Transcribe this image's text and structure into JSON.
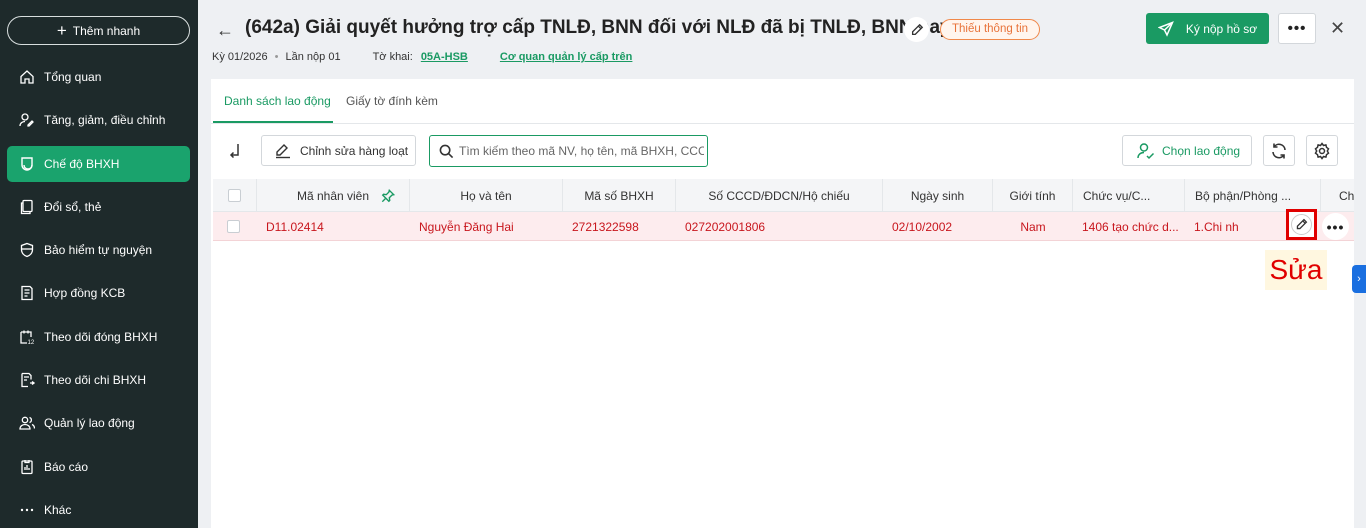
{
  "sidebar": {
    "quick_add": "Thêm nhanh",
    "items": [
      {
        "label": "Tổng quan",
        "icon": "home-icon"
      },
      {
        "label": "Tăng, giảm, điều chỉnh",
        "icon": "user-edit-icon"
      },
      {
        "label": "Chế độ BHXH",
        "icon": "shield-health-icon",
        "active": true
      },
      {
        "label": "Đổi sổ, thẻ",
        "icon": "copy-card-icon"
      },
      {
        "label": "Bảo hiểm tự nguyện",
        "icon": "shield-icon"
      },
      {
        "label": "Hợp đồng KCB",
        "icon": "contract-icon"
      },
      {
        "label": "Theo dõi đóng BHXH",
        "icon": "calendar-track-icon"
      },
      {
        "label": "Theo dõi chi BHXH",
        "icon": "document-track-icon"
      },
      {
        "label": "Quản lý lao động",
        "icon": "users-icon"
      },
      {
        "label": "Báo cáo",
        "icon": "report-icon"
      },
      {
        "label": "Khác",
        "icon": "more-dots-icon"
      }
    ]
  },
  "header": {
    "title": "(642a) Giải quyết hưởng trợ cấp TNLĐ, BNN đối với NLĐ đã bị TNLĐ, BNN nay...",
    "badge": "Thiếu thông tin",
    "submit_label": "Ký nộp hồ sơ",
    "period": "Kỳ 01/2026",
    "submission": "Lần nộp 01",
    "form_label": "Tờ khai:",
    "form_code": "05A-HSB",
    "agency_link": "Cơ quan quản lý cấp trên"
  },
  "tabs": [
    "Danh sách lao động",
    "Giấy tờ đính kèm"
  ],
  "toolbar": {
    "bulk_edit": "Chỉnh sửa hàng loạt",
    "search_placeholder": "Tìm kiếm theo mã NV, họ tên, mã BHXH, CCCD",
    "choose_employee": "Chọn lao động"
  },
  "table": {
    "columns": [
      "Mã nhân viên",
      "Họ và tên",
      "Mã số BHXH",
      "Số CCCD/ĐDCN/Hộ chiếu",
      "Ngày sinh",
      "Giới tính",
      "Chức vụ/C...",
      "Bộ phận/Phòng ...",
      "Ch"
    ],
    "rows": [
      {
        "employee_id": "D11.02414",
        "name": "Nguyễn Đăng Hai",
        "bhxh": "2721322598",
        "cccd": "027202001806",
        "dob": "02/10/2002",
        "gender": "Nam",
        "position": "1406 tạo chức d...",
        "department": "1.Chi nh"
      }
    ]
  },
  "annotation": "Sửa",
  "colors": {
    "sidebar_bg": "#1e2a2b",
    "accent_green": "#1a9a63",
    "warning_orange": "#e8733a",
    "error_red": "#c8161d",
    "highlight_red": "#e00000"
  }
}
